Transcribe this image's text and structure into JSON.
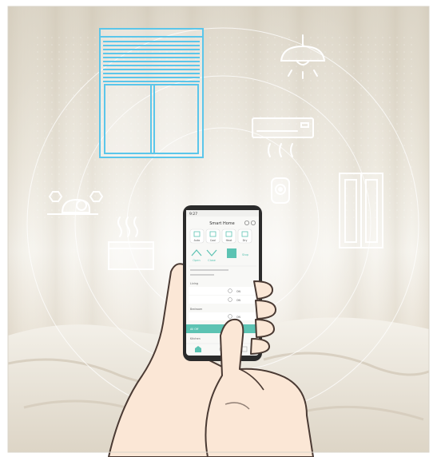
{
  "image": {
    "kind": "illustration",
    "depicts": "hand-holding-smartphone-smart-home-app-with-floating-device-icons"
  },
  "app": {
    "status_time": "9:27",
    "title": "Smart Home",
    "mode_buttons": [
      "Auto",
      "Cool",
      "Heat",
      "Dry"
    ],
    "shutter_controls": {
      "open_label": "Open",
      "close_label": "Close",
      "stop_label": "Stop"
    },
    "section_labels": [
      "Living",
      "Bedroom",
      "Kitchen"
    ],
    "row_status_label": "ON",
    "highlight_row_label": "All Off"
  },
  "icons": [
    "window-shutter-icon",
    "ceiling-lamp-icon",
    "air-conditioner-icon",
    "smart-camera-icon",
    "wardrobe-icon",
    "robot-vacuum-icon",
    "radiator-heater-icon"
  ],
  "colors": {
    "accent_teal": "#5cc3b3",
    "shutter_blue": "#5bc6ea",
    "line_white": "#ffffff",
    "skin": "#fbe7d6",
    "skin_outline": "#4a3a33",
    "phone_body": "#2b2b2b"
  }
}
